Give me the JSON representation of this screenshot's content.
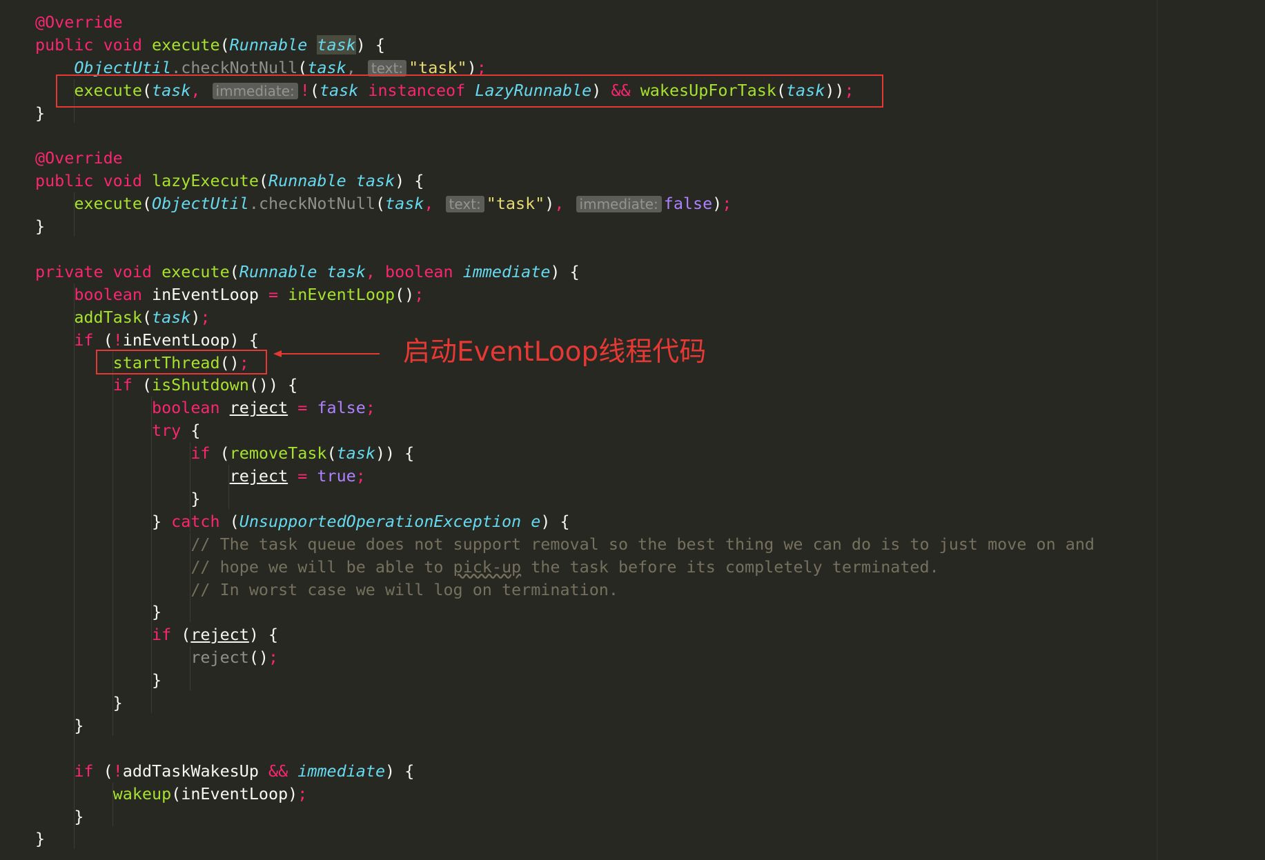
{
  "editor": {
    "colors": {
      "background": "#272822",
      "keyword": "#f92672",
      "function": "#a6e22e",
      "type": "#66d9ef",
      "string": "#e6db74",
      "constant": "#ae81ff",
      "comment": "#75715e",
      "hint_background": "#5c5d58",
      "annotation_red": "#e53935"
    },
    "lines": [
      [
        [
          "kw",
          "@Override"
        ]
      ],
      [
        [
          "kw",
          "public void "
        ],
        [
          "fn",
          "execute"
        ],
        [
          "plain",
          "("
        ],
        [
          "type",
          "Runnable "
        ],
        [
          "param",
          "task",
          "hl"
        ],
        [
          "plain",
          ") {"
        ]
      ],
      [
        [
          "plain",
          "    "
        ],
        [
          "type",
          "ObjectUtil"
        ],
        [
          "muted",
          "."
        ],
        [
          "muted",
          "checkNotNull"
        ],
        [
          "plain",
          "("
        ],
        [
          "param",
          "task"
        ],
        [
          "muted",
          ", "
        ],
        [
          "hint",
          "text:"
        ],
        [
          "str",
          "\"task\""
        ],
        [
          "plain",
          ")"
        ],
        [
          "kw",
          ";"
        ]
      ],
      [
        [
          "plain",
          "    "
        ],
        [
          "fn",
          "execute"
        ],
        [
          "plain",
          "("
        ],
        [
          "param",
          "task"
        ],
        [
          "kw",
          ", "
        ],
        [
          "hint",
          "immediate:"
        ],
        [
          "kw",
          "!"
        ],
        [
          "plain",
          "("
        ],
        [
          "param",
          "task"
        ],
        [
          "kw",
          " instanceof "
        ],
        [
          "type",
          "LazyRunnable"
        ],
        [
          "plain",
          ") "
        ],
        [
          "kw",
          "&&"
        ],
        [
          "plain",
          " "
        ],
        [
          "fn",
          "wakesUpForTask"
        ],
        [
          "plain",
          "("
        ],
        [
          "param",
          "task"
        ],
        [
          "plain",
          "))"
        ],
        [
          "kw",
          ";"
        ]
      ],
      [
        [
          "plain",
          "}"
        ]
      ],
      [],
      [
        [
          "kw",
          "@Override"
        ]
      ],
      [
        [
          "kw",
          "public void "
        ],
        [
          "fn",
          "lazyExecute"
        ],
        [
          "plain",
          "("
        ],
        [
          "type",
          "Runnable "
        ],
        [
          "param",
          "task"
        ],
        [
          "plain",
          ") {"
        ]
      ],
      [
        [
          "plain",
          "    "
        ],
        [
          "fn",
          "execute"
        ],
        [
          "plain",
          "("
        ],
        [
          "type",
          "ObjectUtil"
        ],
        [
          "muted",
          "."
        ],
        [
          "muted",
          "checkNotNull"
        ],
        [
          "plain",
          "("
        ],
        [
          "param",
          "task"
        ],
        [
          "kw",
          ", "
        ],
        [
          "hint",
          "text:"
        ],
        [
          "str",
          "\"task\""
        ],
        [
          "plain",
          ")"
        ],
        [
          "kw",
          ", "
        ],
        [
          "hint",
          "immediate:"
        ],
        [
          "const",
          "false"
        ],
        [
          "plain",
          ")"
        ],
        [
          "kw",
          ";"
        ]
      ],
      [
        [
          "plain",
          "}"
        ]
      ],
      [],
      [
        [
          "kw",
          "private void "
        ],
        [
          "fn",
          "execute"
        ],
        [
          "plain",
          "("
        ],
        [
          "type",
          "Runnable "
        ],
        [
          "param",
          "task"
        ],
        [
          "kw",
          ", boolean "
        ],
        [
          "param",
          "immediate"
        ],
        [
          "plain",
          ") {"
        ]
      ],
      [
        [
          "plain",
          "    "
        ],
        [
          "kw",
          "boolean "
        ],
        [
          "plain",
          "inEventLoop "
        ],
        [
          "kw",
          "= "
        ],
        [
          "fn",
          "inEventLoop"
        ],
        [
          "plain",
          "()"
        ],
        [
          "kw",
          ";"
        ]
      ],
      [
        [
          "plain",
          "    "
        ],
        [
          "fn",
          "addTask"
        ],
        [
          "plain",
          "("
        ],
        [
          "param",
          "task"
        ],
        [
          "plain",
          ")"
        ],
        [
          "kw",
          ";"
        ]
      ],
      [
        [
          "plain",
          "    "
        ],
        [
          "kw",
          "if "
        ],
        [
          "plain",
          "("
        ],
        [
          "kw",
          "!"
        ],
        [
          "plain",
          "inEventLoop) {"
        ]
      ],
      [
        [
          "plain",
          "        "
        ],
        [
          "fn",
          "startThread"
        ],
        [
          "plain",
          "()"
        ],
        [
          "kw",
          ";"
        ]
      ],
      [
        [
          "plain",
          "        "
        ],
        [
          "kw",
          "if "
        ],
        [
          "plain",
          "("
        ],
        [
          "fn",
          "isShutdown"
        ],
        [
          "plain",
          "()) {"
        ]
      ],
      [
        [
          "plain",
          "            "
        ],
        [
          "kw",
          "boolean "
        ],
        [
          "plain",
          "reject",
          "ul"
        ],
        [
          "plain",
          " "
        ],
        [
          "kw",
          "= "
        ],
        [
          "const",
          "false"
        ],
        [
          "kw",
          ";"
        ]
      ],
      [
        [
          "plain",
          "            "
        ],
        [
          "kw",
          "try "
        ],
        [
          "plain",
          "{"
        ]
      ],
      [
        [
          "plain",
          "                "
        ],
        [
          "kw",
          "if "
        ],
        [
          "plain",
          "("
        ],
        [
          "fn",
          "removeTask"
        ],
        [
          "plain",
          "("
        ],
        [
          "param",
          "task"
        ],
        [
          "plain",
          ")) {"
        ]
      ],
      [
        [
          "plain",
          "                    "
        ],
        [
          "plain",
          "reject",
          "ul"
        ],
        [
          "plain",
          " "
        ],
        [
          "kw",
          "= "
        ],
        [
          "const",
          "true"
        ],
        [
          "kw",
          ";"
        ]
      ],
      [
        [
          "plain",
          "                }"
        ]
      ],
      [
        [
          "plain",
          "            } "
        ],
        [
          "kw",
          "catch "
        ],
        [
          "plain",
          "("
        ],
        [
          "type",
          "UnsupportedOperationException "
        ],
        [
          "param",
          "e"
        ],
        [
          "plain",
          ") {"
        ]
      ],
      [
        [
          "plain",
          "                "
        ],
        [
          "cmt",
          "// The task queue does not support removal so the best thing we can do is to just move on and"
        ]
      ],
      [
        [
          "plain",
          "                "
        ],
        [
          "cmt",
          "// hope we will be able to "
        ],
        [
          "cmt",
          "pick-up",
          "wavy"
        ],
        [
          "cmt",
          " the task before its completely terminated."
        ]
      ],
      [
        [
          "plain",
          "                "
        ],
        [
          "cmt",
          "// In worst case we will log on termination."
        ]
      ],
      [
        [
          "plain",
          "            }"
        ]
      ],
      [
        [
          "plain",
          "            "
        ],
        [
          "kw",
          "if "
        ],
        [
          "plain",
          "("
        ],
        [
          "plain",
          "reject",
          "ul"
        ],
        [
          "plain",
          ") {"
        ]
      ],
      [
        [
          "plain",
          "                "
        ],
        [
          "muted",
          "reject"
        ],
        [
          "plain",
          "()"
        ],
        [
          "kw",
          ";"
        ]
      ],
      [
        [
          "plain",
          "            }"
        ]
      ],
      [
        [
          "plain",
          "        }"
        ]
      ],
      [
        [
          "plain",
          "    }"
        ]
      ],
      [],
      [
        [
          "plain",
          "    "
        ],
        [
          "kw",
          "if "
        ],
        [
          "plain",
          "("
        ],
        [
          "kw",
          "!"
        ],
        [
          "plain",
          "addTaskWakesUp "
        ],
        [
          "kw",
          "&& "
        ],
        [
          "param",
          "immediate"
        ],
        [
          "plain",
          ") {"
        ]
      ],
      [
        [
          "plain",
          "        "
        ],
        [
          "fn",
          "wakeup"
        ],
        [
          "plain",
          "(inEventLoop)"
        ],
        [
          "kw",
          ";"
        ]
      ],
      [
        [
          "plain",
          "    }"
        ]
      ],
      [
        [
          "plain",
          "}"
        ]
      ]
    ]
  },
  "annotation": {
    "label": "启动EventLoop线程代码"
  }
}
